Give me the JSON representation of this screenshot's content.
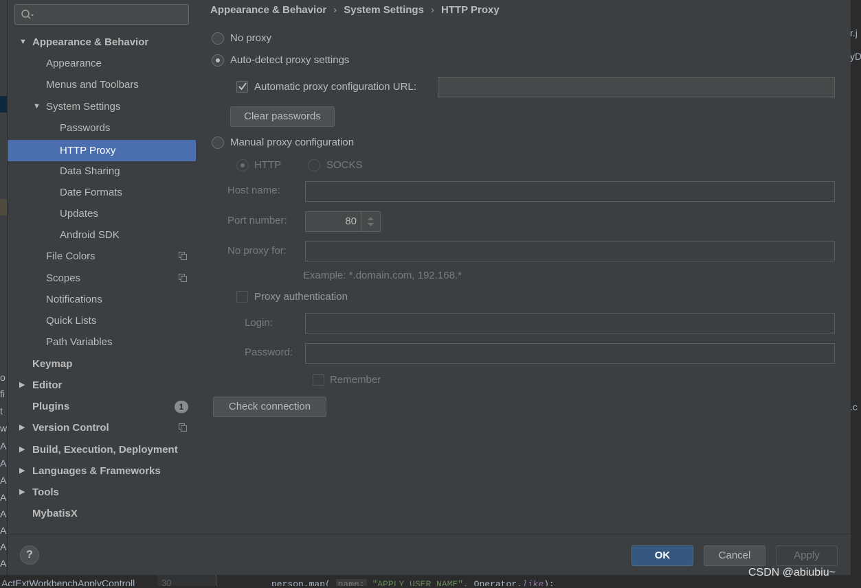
{
  "search": {
    "placeholder": ""
  },
  "breadcrumb": {
    "items": [
      "Appearance & Behavior",
      "System Settings",
      "HTTP Proxy"
    ]
  },
  "sidebar": {
    "items": [
      {
        "label": "Appearance & Behavior",
        "expanded": true
      },
      {
        "label": "Appearance"
      },
      {
        "label": "Menus and Toolbars"
      },
      {
        "label": "System Settings",
        "expanded": true
      },
      {
        "label": "Passwords"
      },
      {
        "label": "HTTP Proxy",
        "selected": true
      },
      {
        "label": "Data Sharing"
      },
      {
        "label": "Date Formats"
      },
      {
        "label": "Updates"
      },
      {
        "label": "Android SDK"
      },
      {
        "label": "File Colors"
      },
      {
        "label": "Scopes"
      },
      {
        "label": "Notifications"
      },
      {
        "label": "Quick Lists"
      },
      {
        "label": "Path Variables"
      },
      {
        "label": "Keymap"
      },
      {
        "label": "Editor"
      },
      {
        "label": "Plugins",
        "badge": "1"
      },
      {
        "label": "Version Control"
      },
      {
        "label": "Build, Execution, Deployment"
      },
      {
        "label": "Languages & Frameworks"
      },
      {
        "label": "Tools"
      },
      {
        "label": "MybatisX"
      }
    ]
  },
  "proxy": {
    "no_proxy": "No proxy",
    "auto_detect": "Auto-detect proxy settings",
    "auto_url_label": "Automatic proxy configuration URL:",
    "auto_url_value": "",
    "clear_passwords": "Clear passwords",
    "manual": "Manual proxy configuration",
    "http": "HTTP",
    "socks": "SOCKS",
    "host_label": "Host name:",
    "host_value": "",
    "port_label": "Port number:",
    "port_value": "80",
    "no_proxy_for_label": "No proxy for:",
    "no_proxy_for_value": "",
    "example": "Example: *.domain.com, 192.168.*",
    "proxy_auth": "Proxy authentication",
    "login_label": "Login:",
    "login_value": "",
    "password_label": "Password:",
    "password_value": "",
    "remember": "Remember",
    "check_connection": "Check connection",
    "selected_mode": "auto_detect",
    "auto_url_checked": true
  },
  "footer": {
    "help": "?",
    "ok": "OK",
    "cancel": "Cancel",
    "apply": "Apply"
  },
  "background": {
    "left_fragments": [
      "o",
      "fi",
      "t",
      "w",
      "A",
      "A",
      "A",
      "A",
      "A",
      "A",
      "A",
      "A"
    ],
    "right_fragments": [
      "r.j",
      "yD",
      ".c"
    ],
    "bottom_file": "ActExtWorkbenchApplyControll",
    "bottom_line_num": "30",
    "code_prefix": "person.map( ",
    "code_hint": "name:",
    "code_str": " \"APPLY_USER_NAME\"",
    "code_mid": ",  Operator.",
    "code_it": "like",
    "code_end": ");"
  },
  "watermark": "CSDN @abiubiu~",
  "colors": {
    "selection": "#4b6eaf",
    "primary_button": "#365880",
    "dialog_bg": "#3c3f41"
  }
}
